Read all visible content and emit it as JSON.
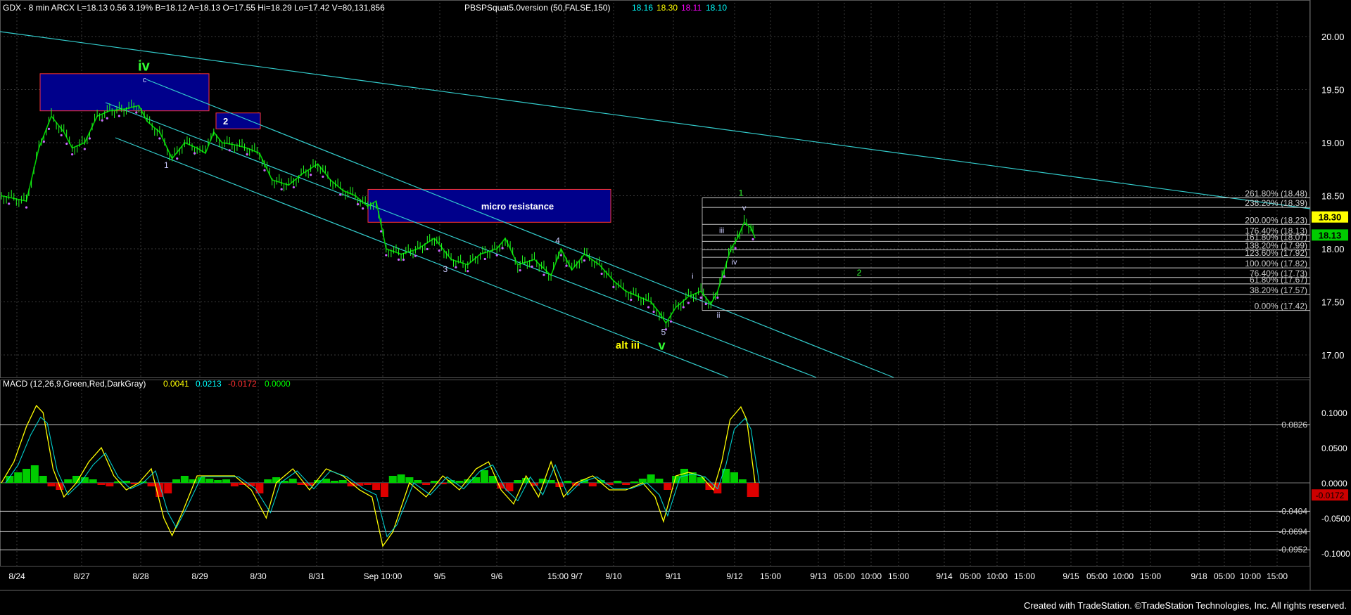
{
  "header": {
    "symbol_info": "GDX - 8 min  ARCX  L=18.13  0.56  3.19%  B=18.12  A=18.13  O=17.55  Hi=18.29  Lo=17.42  V=80,131,856",
    "indicator": "PBSPSquat5.0version (50,FALSE,150)",
    "ind_values": [
      {
        "text": "18.16",
        "color": "#00ffff"
      },
      {
        "text": "18.30",
        "color": "#ffff00"
      },
      {
        "text": "18.11",
        "color": "#ff00ff"
      },
      {
        "text": "18.10",
        "color": "#00ffff"
      }
    ]
  },
  "macd_header": {
    "label": "MACD (12,26,9,Green,Red,DarkGray)",
    "values": [
      {
        "text": "0.0041",
        "color": "#ffff00"
      },
      {
        "text": "0.0213",
        "color": "#00ffff"
      },
      {
        "text": "-0.0172",
        "color": "#ff3030"
      },
      {
        "text": "0.0000",
        "color": "#00ff00"
      }
    ]
  },
  "footer": "Created with TradeStation. ©TradeStation Technologies, Inc. All rights reserved.",
  "chart_data": [
    {
      "type": "candlestick",
      "title": "GDX - 8 min",
      "ylim": [
        16.75,
        20.4
      ],
      "y_ticks": [
        "20.00",
        "19.50",
        "19.00",
        "18.50",
        "18.00",
        "17.50",
        "17.00"
      ],
      "x_ticks": [
        "8/24",
        "8/27",
        "8/28",
        "8/29",
        "8/30",
        "8/31",
        "Sep 10:00",
        "9/5",
        "9/6",
        "15:00 9/7",
        "9/10",
        "9/11",
        "9/12",
        "15:00",
        "9/13",
        "05:00",
        "10:00",
        "15:00",
        "9/14",
        "05:00",
        "10:00",
        "15:00",
        "9/15",
        "05:00",
        "10:00",
        "15:00",
        "9/18",
        "05:00",
        "10:00",
        "15:00"
      ],
      "price_path": [
        [
          0,
          18.5
        ],
        [
          30,
          18.45
        ],
        [
          45,
          18.95
        ],
        [
          60,
          19.25
        ],
        [
          75,
          19.1
        ],
        [
          85,
          18.95
        ],
        [
          100,
          19.0
        ],
        [
          115,
          19.25
        ],
        [
          130,
          19.3
        ],
        [
          150,
          19.32
        ],
        [
          165,
          19.35
        ],
        [
          175,
          19.2
        ],
        [
          190,
          19.1
        ],
        [
          205,
          18.85
        ],
        [
          220,
          19.0
        ],
        [
          235,
          18.95
        ],
        [
          245,
          18.9
        ],
        [
          255,
          19.1
        ],
        [
          265,
          19.0
        ],
        [
          280,
          18.98
        ],
        [
          295,
          18.95
        ],
        [
          310,
          18.9
        ],
        [
          325,
          18.65
        ],
        [
          345,
          18.6
        ],
        [
          360,
          18.7
        ],
        [
          380,
          18.8
        ],
        [
          395,
          18.65
        ],
        [
          410,
          18.55
        ],
        [
          425,
          18.5
        ],
        [
          440,
          18.4
        ],
        [
          450,
          18.45
        ],
        [
          462,
          18.0
        ],
        [
          480,
          17.95
        ],
        [
          500,
          18.0
        ],
        [
          520,
          18.1
        ],
        [
          540,
          17.9
        ],
        [
          560,
          17.85
        ],
        [
          575,
          17.95
        ],
        [
          595,
          18.0
        ],
        [
          605,
          18.1
        ],
        [
          620,
          17.85
        ],
        [
          640,
          17.9
        ],
        [
          660,
          17.75
        ],
        [
          672,
          18.0
        ],
        [
          685,
          17.8
        ],
        [
          700,
          17.95
        ],
        [
          718,
          17.85
        ],
        [
          735,
          17.7
        ],
        [
          750,
          17.6
        ],
        [
          765,
          17.55
        ],
        [
          780,
          17.5
        ],
        [
          790,
          17.4
        ],
        [
          798,
          17.3
        ],
        [
          810,
          17.45
        ],
        [
          825,
          17.55
        ],
        [
          840,
          17.6
        ],
        [
          852,
          17.48
        ],
        [
          860,
          17.6
        ],
        [
          868,
          17.8
        ],
        [
          876,
          18.0
        ],
        [
          884,
          18.1
        ],
        [
          892,
          18.25
        ],
        [
          900,
          18.2
        ],
        [
          905,
          18.1
        ]
      ],
      "resistance_boxes": [
        {
          "price_range": [
            19.3,
            19.65
          ],
          "label": ""
        },
        {
          "price_range": [
            19.13,
            19.28
          ],
          "label": "2"
        },
        {
          "price_range": [
            18.25,
            18.56
          ],
          "label": "micro resistance"
        }
      ],
      "fib_levels": [
        {
          "label": "261.80% (18.48)",
          "price": 18.48
        },
        {
          "label": "238.20% (18.39)",
          "price": 18.39
        },
        {
          "label": "200.00% (18.23)",
          "price": 18.23
        },
        {
          "label": "176.40% (18.13)",
          "price": 18.13
        },
        {
          "label": "161.80% (18.07)",
          "price": 18.07
        },
        {
          "label": "138.20% (17.99)",
          "price": 17.99
        },
        {
          "label": "123.60% (17.92)",
          "price": 17.92
        },
        {
          "label": "100.00% (17.82)",
          "price": 17.82
        },
        {
          "label": "76.40% (17.73)",
          "price": 17.73
        },
        {
          "label": "61.80% (17.67)",
          "price": 17.67
        },
        {
          "label": "38.20% (17.57)",
          "price": 17.57
        },
        {
          "label": "0.00% (17.42)",
          "price": 17.42
        }
      ],
      "price_markers": [
        {
          "text": "18.30",
          "price": 18.3,
          "bg": "#ffff00",
          "fg": "#000000"
        },
        {
          "text": "18.13",
          "price": 18.13,
          "bg": "#00cc00",
          "fg": "#000000"
        }
      ],
      "wave_labels": [
        {
          "text": "iv",
          "color": "#33ff33",
          "size": 20,
          "bold": true,
          "anchor": [
            171,
            19.68
          ]
        },
        {
          "text": "c",
          "color": "#ccccff",
          "size": 11,
          "anchor": [
            172,
            19.57
          ]
        },
        {
          "text": "1",
          "color": "#ccccff",
          "size": 12,
          "anchor": [
            198,
            18.76
          ]
        },
        {
          "text": "3",
          "color": "#ccccff",
          "size": 12,
          "anchor": [
            533,
            17.78
          ]
        },
        {
          "text": "4",
          "color": "#ccccff",
          "size": 12,
          "anchor": [
            668,
            18.05
          ]
        },
        {
          "text": "5",
          "color": "#ccccff",
          "size": 12,
          "anchor": [
            795,
            17.19
          ]
        },
        {
          "text": "alt iii",
          "color": "#ffff00",
          "size": 15,
          "bold": true,
          "anchor": [
            752,
            17.06
          ]
        },
        {
          "text": "v",
          "color": "#33ff33",
          "size": 18,
          "bold": true,
          "anchor": [
            793,
            17.05
          ]
        },
        {
          "text": "i",
          "color": "#ccccff",
          "size": 11,
          "anchor": [
            830,
            17.72
          ]
        },
        {
          "text": "ii",
          "color": "#ccccff",
          "size": 11,
          "anchor": [
            861,
            17.35
          ]
        },
        {
          "text": "iii",
          "color": "#ccccff",
          "size": 11,
          "anchor": [
            865,
            18.15
          ]
        },
        {
          "text": "iv",
          "color": "#ccccff",
          "size": 11,
          "anchor": [
            880,
            17.85
          ]
        },
        {
          "text": "v",
          "color": "#ccccff",
          "size": 11,
          "anchor": [
            892,
            18.36
          ]
        },
        {
          "text": "1",
          "color": "#33ff33",
          "size": 12,
          "anchor": [
            888,
            18.5
          ]
        },
        {
          "text": "2",
          "color": "#33ff33",
          "size": 12,
          "anchor": [
            1030,
            17.75
          ]
        }
      ]
    },
    {
      "type": "histogram",
      "title": "MACD (12,26,9,Green,Red,DarkGray)",
      "ylim": [
        -0.115,
        0.125
      ],
      "y_ticks": [
        "0.1000",
        "0.0500",
        "0.0000",
        "-0.0500",
        "-0.1000"
      ],
      "ref_levels": [
        {
          "label": "0.0826",
          "value": 0.0826
        },
        {
          "label": "-0.0404",
          "value": -0.0404
        },
        {
          "label": "-0.0694",
          "value": -0.0694
        },
        {
          "label": "-0.0952",
          "value": -0.0952
        }
      ],
      "value_marker": {
        "text": "-0.0172",
        "value": -0.0172,
        "bg": "#cc0000",
        "fg": "#000000"
      },
      "macd_line": [
        [
          0,
          0.0
        ],
        [
          15,
          0.03
        ],
        [
          30,
          0.08
        ],
        [
          42,
          0.11
        ],
        [
          50,
          0.1
        ],
        [
          62,
          0.02
        ],
        [
          75,
          -0.02
        ],
        [
          90,
          0.0
        ],
        [
          105,
          0.03
        ],
        [
          120,
          0.05
        ],
        [
          135,
          0.01
        ],
        [
          150,
          -0.01
        ],
        [
          165,
          0.0
        ],
        [
          180,
          0.02
        ],
        [
          195,
          -0.05
        ],
        [
          205,
          -0.075
        ],
        [
          218,
          -0.04
        ],
        [
          235,
          0.01
        ],
        [
          260,
          0.01
        ],
        [
          280,
          0.01
        ],
        [
          300,
          -0.01
        ],
        [
          318,
          -0.05
        ],
        [
          330,
          0.0
        ],
        [
          350,
          0.02
        ],
        [
          370,
          -0.01
        ],
        [
          390,
          0.02
        ],
        [
          410,
          0.01
        ],
        [
          430,
          -0.01
        ],
        [
          445,
          -0.02
        ],
        [
          458,
          -0.09
        ],
        [
          470,
          -0.07
        ],
        [
          490,
          0.0
        ],
        [
          510,
          -0.02
        ],
        [
          530,
          0.01
        ],
        [
          550,
          -0.01
        ],
        [
          570,
          0.02
        ],
        [
          585,
          0.03
        ],
        [
          600,
          -0.01
        ],
        [
          615,
          -0.03
        ],
        [
          630,
          0.01
        ],
        [
          645,
          -0.02
        ],
        [
          660,
          0.03
        ],
        [
          675,
          -0.02
        ],
        [
          690,
          0.0
        ],
        [
          710,
          0.01
        ],
        [
          730,
          -0.01
        ],
        [
          750,
          -0.01
        ],
        [
          770,
          0.0
        ],
        [
          785,
          -0.02
        ],
        [
          795,
          -0.055
        ],
        [
          810,
          0.01
        ],
        [
          825,
          0.015
        ],
        [
          840,
          0.01
        ],
        [
          855,
          -0.01
        ],
        [
          865,
          0.03
        ],
        [
          875,
          0.09
        ],
        [
          888,
          0.108
        ],
        [
          895,
          0.09
        ],
        [
          905,
          0.0
        ]
      ],
      "histogram": [
        [
          0,
          0.0
        ],
        [
          10,
          0.01
        ],
        [
          20,
          0.015
        ],
        [
          30,
          0.02
        ],
        [
          40,
          0.025
        ],
        [
          50,
          0.01
        ],
        [
          60,
          -0.005
        ],
        [
          70,
          -0.01
        ],
        [
          80,
          0.005
        ],
        [
          90,
          0.01
        ],
        [
          100,
          0.008
        ],
        [
          110,
          0.005
        ],
        [
          120,
          -0.003
        ],
        [
          130,
          -0.005
        ],
        [
          140,
          0.002
        ],
        [
          150,
          0.003
        ],
        [
          160,
          -0.002
        ],
        [
          170,
          0.002
        ],
        [
          180,
          -0.005
        ],
        [
          190,
          -0.02
        ],
        [
          200,
          -0.015
        ],
        [
          210,
          0.005
        ],
        [
          220,
          0.01
        ],
        [
          230,
          0.005
        ],
        [
          240,
          0.008
        ],
        [
          250,
          0.006
        ],
        [
          260,
          0.004
        ],
        [
          270,
          0.005
        ],
        [
          280,
          -0.005
        ],
        [
          290,
          -0.003
        ],
        [
          300,
          -0.005
        ],
        [
          310,
          -0.015
        ],
        [
          320,
          0.005
        ],
        [
          330,
          0.008
        ],
        [
          340,
          0.003
        ],
        [
          350,
          0.006
        ],
        [
          360,
          -0.003
        ],
        [
          370,
          -0.004
        ],
        [
          380,
          0.004
        ],
        [
          390,
          0.006
        ],
        [
          400,
          0.003
        ],
        [
          410,
          0.004
        ],
        [
          420,
          -0.005
        ],
        [
          430,
          -0.004
        ],
        [
          440,
          -0.003
        ],
        [
          450,
          -0.01
        ],
        [
          460,
          -0.02
        ],
        [
          470,
          0.01
        ],
        [
          480,
          0.012
        ],
        [
          490,
          0.008
        ],
        [
          500,
          0.004
        ],
        [
          510,
          -0.003
        ],
        [
          520,
          0.003
        ],
        [
          530,
          -0.002
        ],
        [
          540,
          0.004
        ],
        [
          550,
          0.003
        ],
        [
          560,
          0.005
        ],
        [
          570,
          0.008
        ],
        [
          580,
          0.018
        ],
        [
          590,
          0.01
        ],
        [
          600,
          -0.008
        ],
        [
          610,
          -0.012
        ],
        [
          620,
          0.004
        ],
        [
          630,
          0.007
        ],
        [
          640,
          -0.004
        ],
        [
          650,
          0.006
        ],
        [
          660,
          0.004
        ],
        [
          670,
          -0.006
        ],
        [
          680,
          0.003
        ],
        [
          690,
          -0.004
        ],
        [
          700,
          0.005
        ],
        [
          710,
          -0.005
        ],
        [
          720,
          0.004
        ],
        [
          730,
          -0.003
        ],
        [
          740,
          0.003
        ],
        [
          750,
          -0.003
        ],
        [
          760,
          0.002
        ],
        [
          770,
          0.006
        ],
        [
          780,
          0.012
        ],
        [
          790,
          0.006
        ],
        [
          800,
          -0.01
        ],
        [
          810,
          0.01
        ],
        [
          820,
          0.02
        ],
        [
          830,
          0.015
        ],
        [
          840,
          0.008
        ],
        [
          850,
          -0.01
        ],
        [
          860,
          -0.015
        ],
        [
          870,
          0.02
        ],
        [
          880,
          0.015
        ],
        [
          890,
          0.005
        ],
        [
          900,
          -0.02
        ],
        [
          905,
          -0.02
        ]
      ]
    }
  ]
}
